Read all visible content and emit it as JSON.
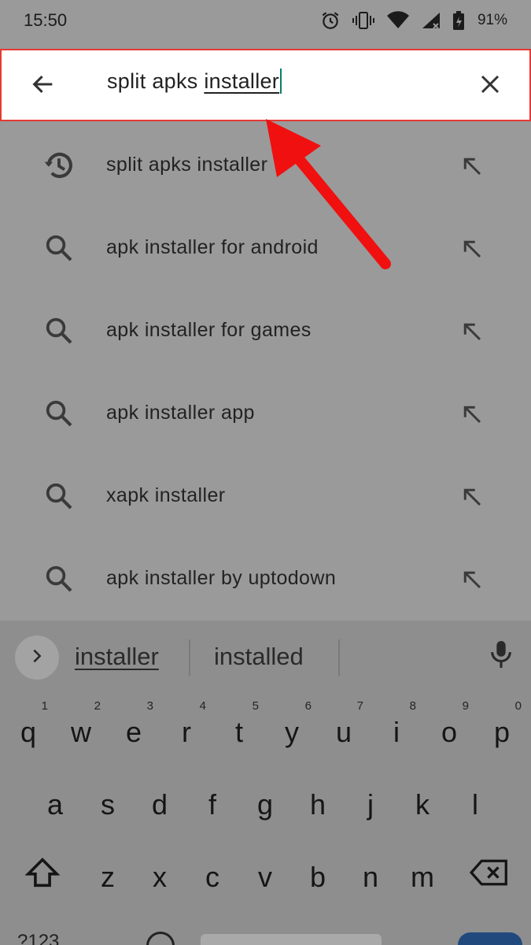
{
  "status_bar": {
    "time": "15:50",
    "battery_percent": "91%",
    "icons": [
      "alarm-icon",
      "vibrate-icon",
      "wifi-icon",
      "cell-signal-icon",
      "battery-icon"
    ]
  },
  "search": {
    "query_prefix": "split apks ",
    "query_composing": "installer",
    "back_icon": "arrow-left-icon",
    "clear_icon": "close-icon",
    "border_color": "#e53935"
  },
  "suggestions": [
    {
      "label": "split apks installer",
      "icon": "history-icon"
    },
    {
      "label": "apk installer for android",
      "icon": "search-icon"
    },
    {
      "label": "apk installer for games",
      "icon": "search-icon"
    },
    {
      "label": "apk installer app",
      "icon": "search-icon"
    },
    {
      "label": "xapk installer",
      "icon": "search-icon"
    },
    {
      "label": "apk installer by uptodown",
      "icon": "search-icon"
    }
  ],
  "annotation": {
    "color": "#f01010",
    "icon": "red-arrow-icon"
  },
  "keyboard": {
    "strip_words": [
      "installer",
      "installed"
    ],
    "row1": [
      {
        "k": "q",
        "h": "1"
      },
      {
        "k": "w",
        "h": "2"
      },
      {
        "k": "e",
        "h": "3"
      },
      {
        "k": "r",
        "h": "4"
      },
      {
        "k": "t",
        "h": "5"
      },
      {
        "k": "y",
        "h": "6"
      },
      {
        "k": "u",
        "h": "7"
      },
      {
        "k": "i",
        "h": "8"
      },
      {
        "k": "o",
        "h": "9"
      },
      {
        "k": "p",
        "h": "0"
      }
    ],
    "row2": [
      "a",
      "s",
      "d",
      "f",
      "g",
      "h",
      "j",
      "k",
      "l"
    ],
    "row3": [
      "z",
      "x",
      "c",
      "v",
      "b",
      "n",
      "m"
    ],
    "bottom_left": "?123"
  }
}
